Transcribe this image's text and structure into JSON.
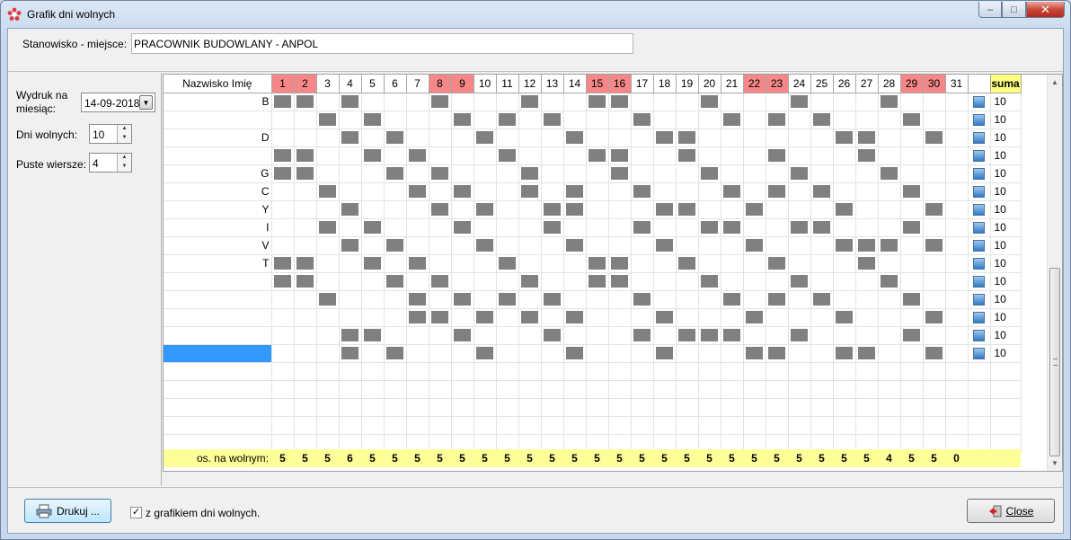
{
  "window": {
    "title": "Grafik dni wolnych",
    "title_icon": "flower-app-icon",
    "controls": [
      "minimize",
      "maximize",
      "close"
    ]
  },
  "station": {
    "label": "Stanowisko - miejsce:",
    "value": "PRACOWNIK BUDOWLANY - ANPOL"
  },
  "left_panel": {
    "month_label": "Wydruk na miesiąc:",
    "month_value": "14-09-2018",
    "days_off_label": "Dni wolnych:",
    "days_off_value": "10",
    "empty_rows_label": "Puste wiersze:",
    "empty_rows_value": "4"
  },
  "grid": {
    "name_header": "Nazwisko Imię",
    "days": [
      "1",
      "2",
      "3",
      "4",
      "5",
      "6",
      "7",
      "8",
      "9",
      "10",
      "11",
      "12",
      "13",
      "14",
      "15",
      "16",
      "17",
      "18",
      "19",
      "20",
      "21",
      "22",
      "23",
      "24",
      "25",
      "26",
      "27",
      "28",
      "29",
      "30",
      "31"
    ],
    "weekend_days": [
      1,
      2,
      8,
      9,
      15,
      16,
      22,
      23,
      29,
      30
    ],
    "sum_header": "suma",
    "name_fragments": [
      "B",
      "",
      "D",
      "",
      "G",
      "C",
      "Y",
      "I",
      "V",
      "T",
      "",
      "",
      "",
      "",
      "",
      ""
    ],
    "rows_off": [
      [
        1,
        2,
        4,
        8,
        12,
        15,
        16,
        20,
        24,
        28
      ],
      [
        3,
        5,
        9,
        11,
        13,
        17,
        21,
        23,
        25,
        29
      ],
      [
        4,
        6,
        10,
        14,
        18,
        19,
        26,
        27,
        30
      ],
      [
        1,
        2,
        5,
        7,
        11,
        15,
        16,
        19,
        23,
        27
      ],
      [
        1,
        2,
        6,
        8,
        12,
        16,
        20,
        24,
        28
      ],
      [
        3,
        7,
        9,
        12,
        14,
        17,
        21,
        23,
        25,
        29
      ],
      [
        4,
        8,
        10,
        13,
        14,
        18,
        19,
        22,
        26,
        30
      ],
      [
        3,
        5,
        9,
        13,
        17,
        20,
        21,
        24,
        25,
        29
      ],
      [
        4,
        6,
        10,
        14,
        18,
        22,
        26,
        27,
        28,
        30
      ],
      [
        1,
        2,
        5,
        7,
        11,
        15,
        16,
        19,
        23,
        27
      ],
      [
        1,
        2,
        6,
        8,
        12,
        15,
        16,
        20,
        24,
        28
      ],
      [
        3,
        7,
        9,
        11,
        13,
        17,
        21,
        23,
        25,
        29
      ],
      [
        7,
        8,
        10,
        12,
        14,
        18,
        22,
        26,
        30
      ],
      [
        4,
        5,
        9,
        13,
        17,
        19,
        20,
        21,
        24,
        29
      ],
      [
        4,
        6,
        10,
        14,
        18,
        22,
        23,
        26,
        27,
        30
      ]
    ],
    "row_count": 15,
    "checked_icon": "checkbox-checked-icon",
    "row_sums": [
      "10",
      "10",
      "10",
      "10",
      "10",
      "10",
      "10",
      "10",
      "10",
      "10",
      "10",
      "10",
      "10",
      "10",
      "10"
    ],
    "footer_label": "os. na wolnym:",
    "footer_values": [
      "5",
      "5",
      "5",
      "6",
      "5",
      "5",
      "5",
      "5",
      "5",
      "5",
      "5",
      "5",
      "5",
      "5",
      "5",
      "5",
      "5",
      "5",
      "5",
      "5",
      "5",
      "5",
      "5",
      "5",
      "5",
      "5",
      "5",
      "4",
      "5",
      "5",
      "0"
    ]
  },
  "bottom": {
    "print_label": "Drukuj ...",
    "print_icon": "printer-icon",
    "checkbox_checked": true,
    "checkbox_label": "z grafikiem dni wolnych.",
    "close_label": "Close",
    "close_icon": "exit-door-icon"
  },
  "colors": {
    "weekend_header": "#f58787",
    "sum_header": "#ffff80",
    "footer_bg": "#ffff99",
    "off_cell": "#808080",
    "selected_row": "#3399ff"
  }
}
